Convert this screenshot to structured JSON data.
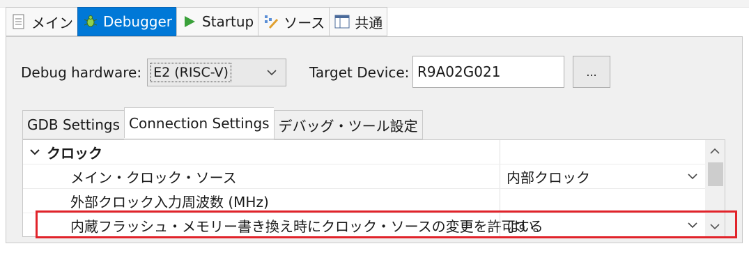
{
  "top_tabs": [
    {
      "label": "メイン",
      "icon": "document-icon"
    },
    {
      "label": "Debugger",
      "icon": "bug-icon"
    },
    {
      "label": "Startup",
      "icon": "play-icon"
    },
    {
      "label": "ソース",
      "icon": "source-icon"
    },
    {
      "label": "共通",
      "icon": "table-icon"
    }
  ],
  "hardware": {
    "label": "Debug hardware:",
    "value": "E2 (RISC-V)"
  },
  "target": {
    "label": "Target Device:",
    "value": "R9A02G021",
    "browse_label": "..."
  },
  "sub_tabs": [
    "GDB Settings",
    "Connection Settings",
    "デバッグ・ツール設定"
  ],
  "grid": {
    "group": "クロック",
    "rows": [
      {
        "name": "メイン・クロック・ソース",
        "value": "内部クロック"
      },
      {
        "name": "外部クロック入力周波数 (MHz)",
        "value": ""
      },
      {
        "name": "内蔵フラッシュ・メモリー書き換え時にクロック・ソースの変更を許可する",
        "value": "はい"
      }
    ]
  },
  "colors": {
    "active_tab": "#0078d7",
    "highlight": "#e1232a"
  }
}
